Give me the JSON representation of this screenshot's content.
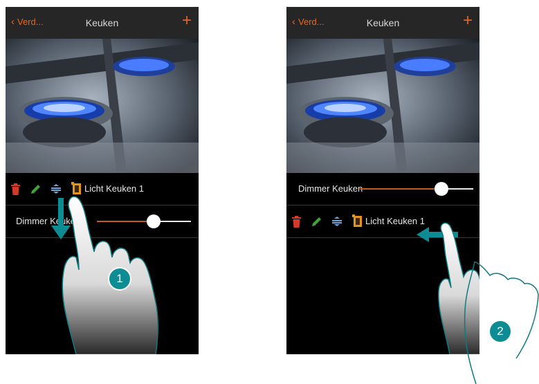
{
  "screens": [
    {
      "header": {
        "back_label": "Verd...",
        "title": "Keuken",
        "add_label": "+"
      },
      "rows": [
        {
          "kind": "edit",
          "label": "Licht Keuken 1"
        },
        {
          "kind": "slider",
          "label": "Dimmer Keuken",
          "level": 0.6
        }
      ],
      "step": "1"
    },
    {
      "header": {
        "back_label": "Verd...",
        "title": "Keuken",
        "add_label": "+"
      },
      "rows": [
        {
          "kind": "slider",
          "label": "Dimmer Keuken",
          "level": 0.72
        },
        {
          "kind": "edit",
          "label": "Licht Keuken 1"
        }
      ],
      "step": "2"
    }
  ],
  "colors": {
    "accent": "#e8641b",
    "step_badge": "#0e8c94",
    "trash": "#d23a2a",
    "pencil": "#3fa33a",
    "move": "#6fa6d8"
  },
  "icons": [
    "chevron-left-icon",
    "plus-icon",
    "trash-icon",
    "pencil-icon",
    "move-icon",
    "light-switch-icon"
  ]
}
